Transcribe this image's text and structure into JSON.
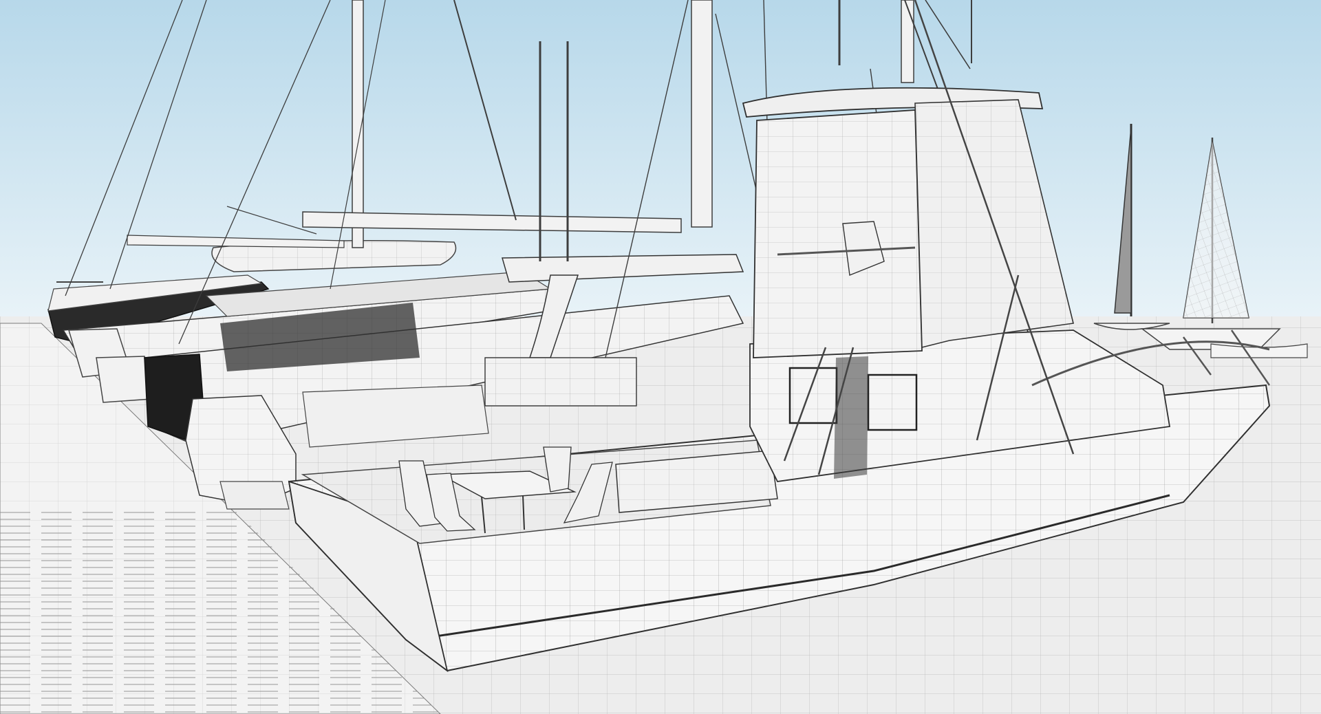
{
  "scene": {
    "description_tags": [
      "wireframe-render",
      "marina",
      "sport-fishing-boat",
      "sailboats",
      "dock"
    ],
    "colors": {
      "sky_top": "#b7d8ea",
      "sky_bottom": "#e9f3f8",
      "water": "#ececec",
      "hull": "#f4f4f4",
      "wire": "#4a4a4a",
      "wire_light": "#9a9a9a",
      "dock": "#f3f3f3",
      "dark_hull": "#2a2a2a"
    }
  }
}
